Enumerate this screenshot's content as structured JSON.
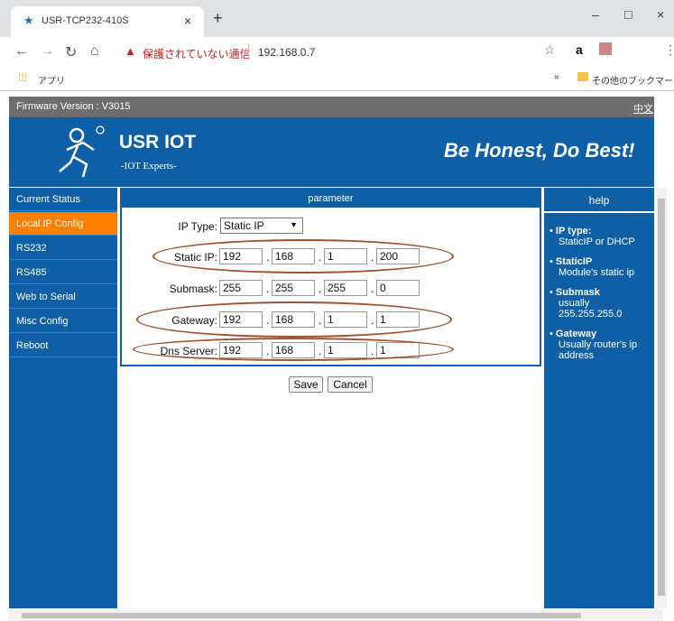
{
  "browser": {
    "tab_title": "USR-TCP232-410S",
    "tab_close": "×",
    "new_tab": "+",
    "window_min": "–",
    "window_max": "□",
    "window_close": "×",
    "address": {
      "security_label": "保護されていない通信",
      "url": "192.168.0.7"
    },
    "bookmarks": {
      "apps_label": "アプリ",
      "more": "»",
      "other_bookmarks": "その他のブックマーク"
    }
  },
  "page": {
    "firmware_label": "Firmware Version : V3015",
    "lang_link": "中文",
    "brand_title": "USR IOT",
    "brand_subtitle": "-IOT Experts-",
    "slogan": "Be Honest, Do Best!",
    "sidebar": [
      {
        "label": "Current Status",
        "active": false
      },
      {
        "label": "Local IP Config",
        "active": true
      },
      {
        "label": "RS232",
        "active": false
      },
      {
        "label": "RS485",
        "active": false
      },
      {
        "label": "Web to Serial",
        "active": false
      },
      {
        "label": "Misc Config",
        "active": false
      },
      {
        "label": "Reboot",
        "active": false
      }
    ],
    "parameter_header": "parameter",
    "form": {
      "ip_type_label": "IP Type:",
      "ip_type_value": "Static IP",
      "static_ip_label": "Static IP:",
      "static_ip": [
        "192",
        "168",
        "1",
        "200"
      ],
      "submask_label": "Submask:",
      "submask": [
        "255",
        "255",
        "255",
        "0"
      ],
      "gateway_label": "Gateway:",
      "gateway": [
        "192",
        "168",
        "1",
        "1"
      ],
      "dns_label": "Dns Server:",
      "dns": [
        "192",
        "168",
        "1",
        "1"
      ],
      "dot": "."
    },
    "buttons": {
      "save": "Save",
      "cancel": "Cancel"
    },
    "help": {
      "header": "help",
      "items": [
        {
          "title": "IP type:",
          "desc": "StaticIP or DHCP"
        },
        {
          "title": "StaticIP",
          "desc": "Module's static ip"
        },
        {
          "title": "Submask",
          "desc": "usually 255.255.255.0"
        },
        {
          "title": "Gateway",
          "desc": "Usually router's ip address"
        }
      ]
    }
  },
  "colors": {
    "brand_blue": "#0e5fa5",
    "active_orange": "#ff7f00",
    "annotation_brown": "#a0522d"
  }
}
